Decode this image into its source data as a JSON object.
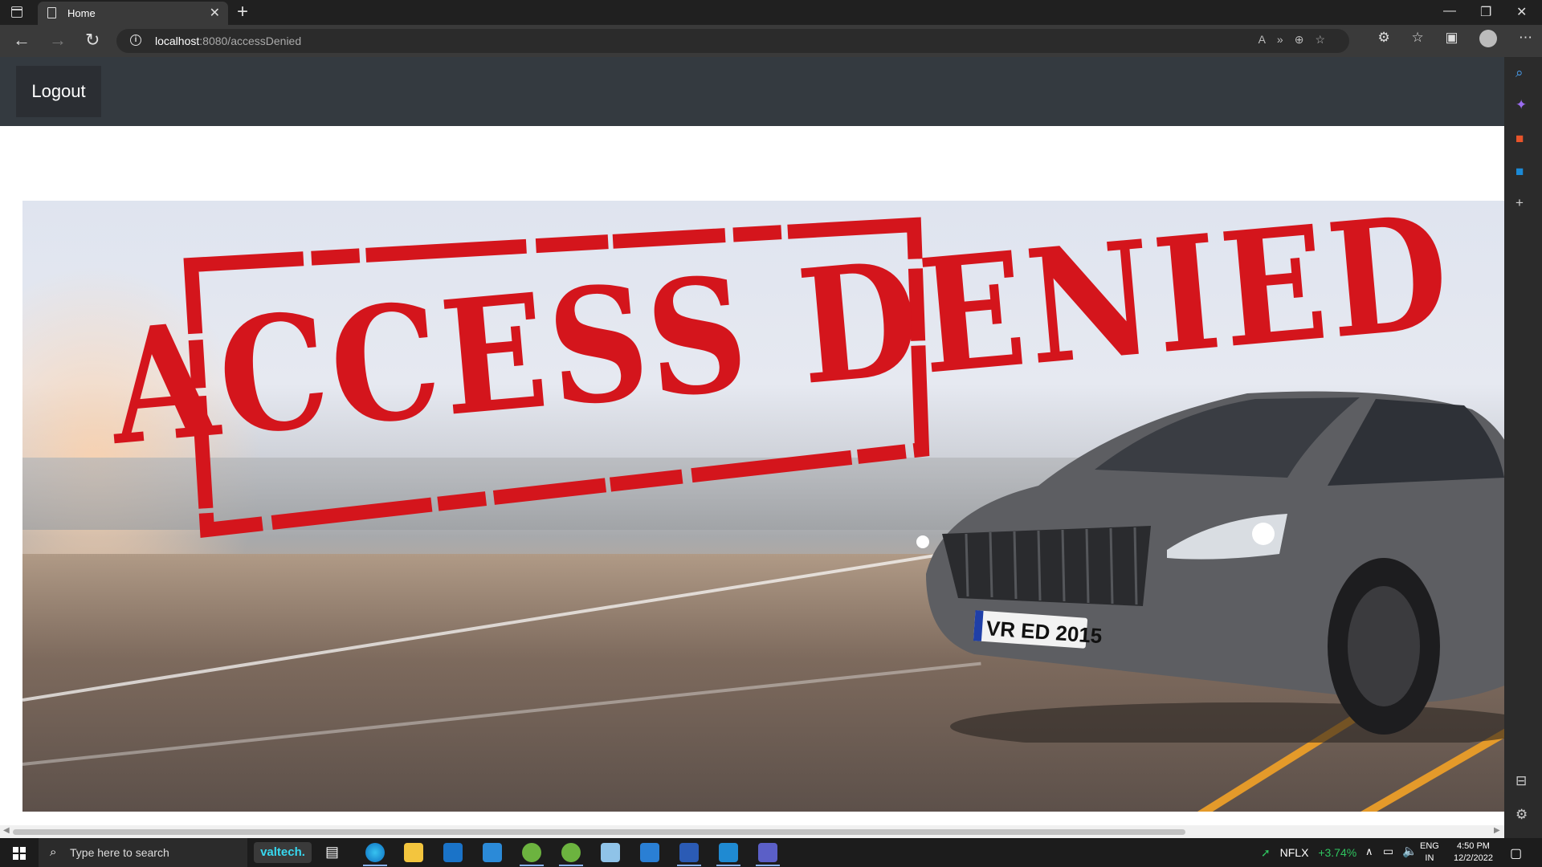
{
  "browser": {
    "tab_title": "Home",
    "url_host": "localhost",
    "url_path": ":8080/accessDenied"
  },
  "page": {
    "logout_label": "Logout",
    "hero": {
      "stamp_text": "ACCESS DENIED",
      "license_plate": "VR ED 2015"
    }
  },
  "taskbar": {
    "search_placeholder": "Type here to search",
    "pinned_label": "valtech.",
    "stock_ticker": "NFLX",
    "stock_change": "+3.74%",
    "lang_top": "ENG",
    "lang_bottom": "IN",
    "time": "4:50 PM",
    "date": "12/2/2022"
  },
  "colors": {
    "navbar_bg": "#343a40",
    "stamp_red": "#d4151c",
    "stock_up": "#2fc45f"
  }
}
